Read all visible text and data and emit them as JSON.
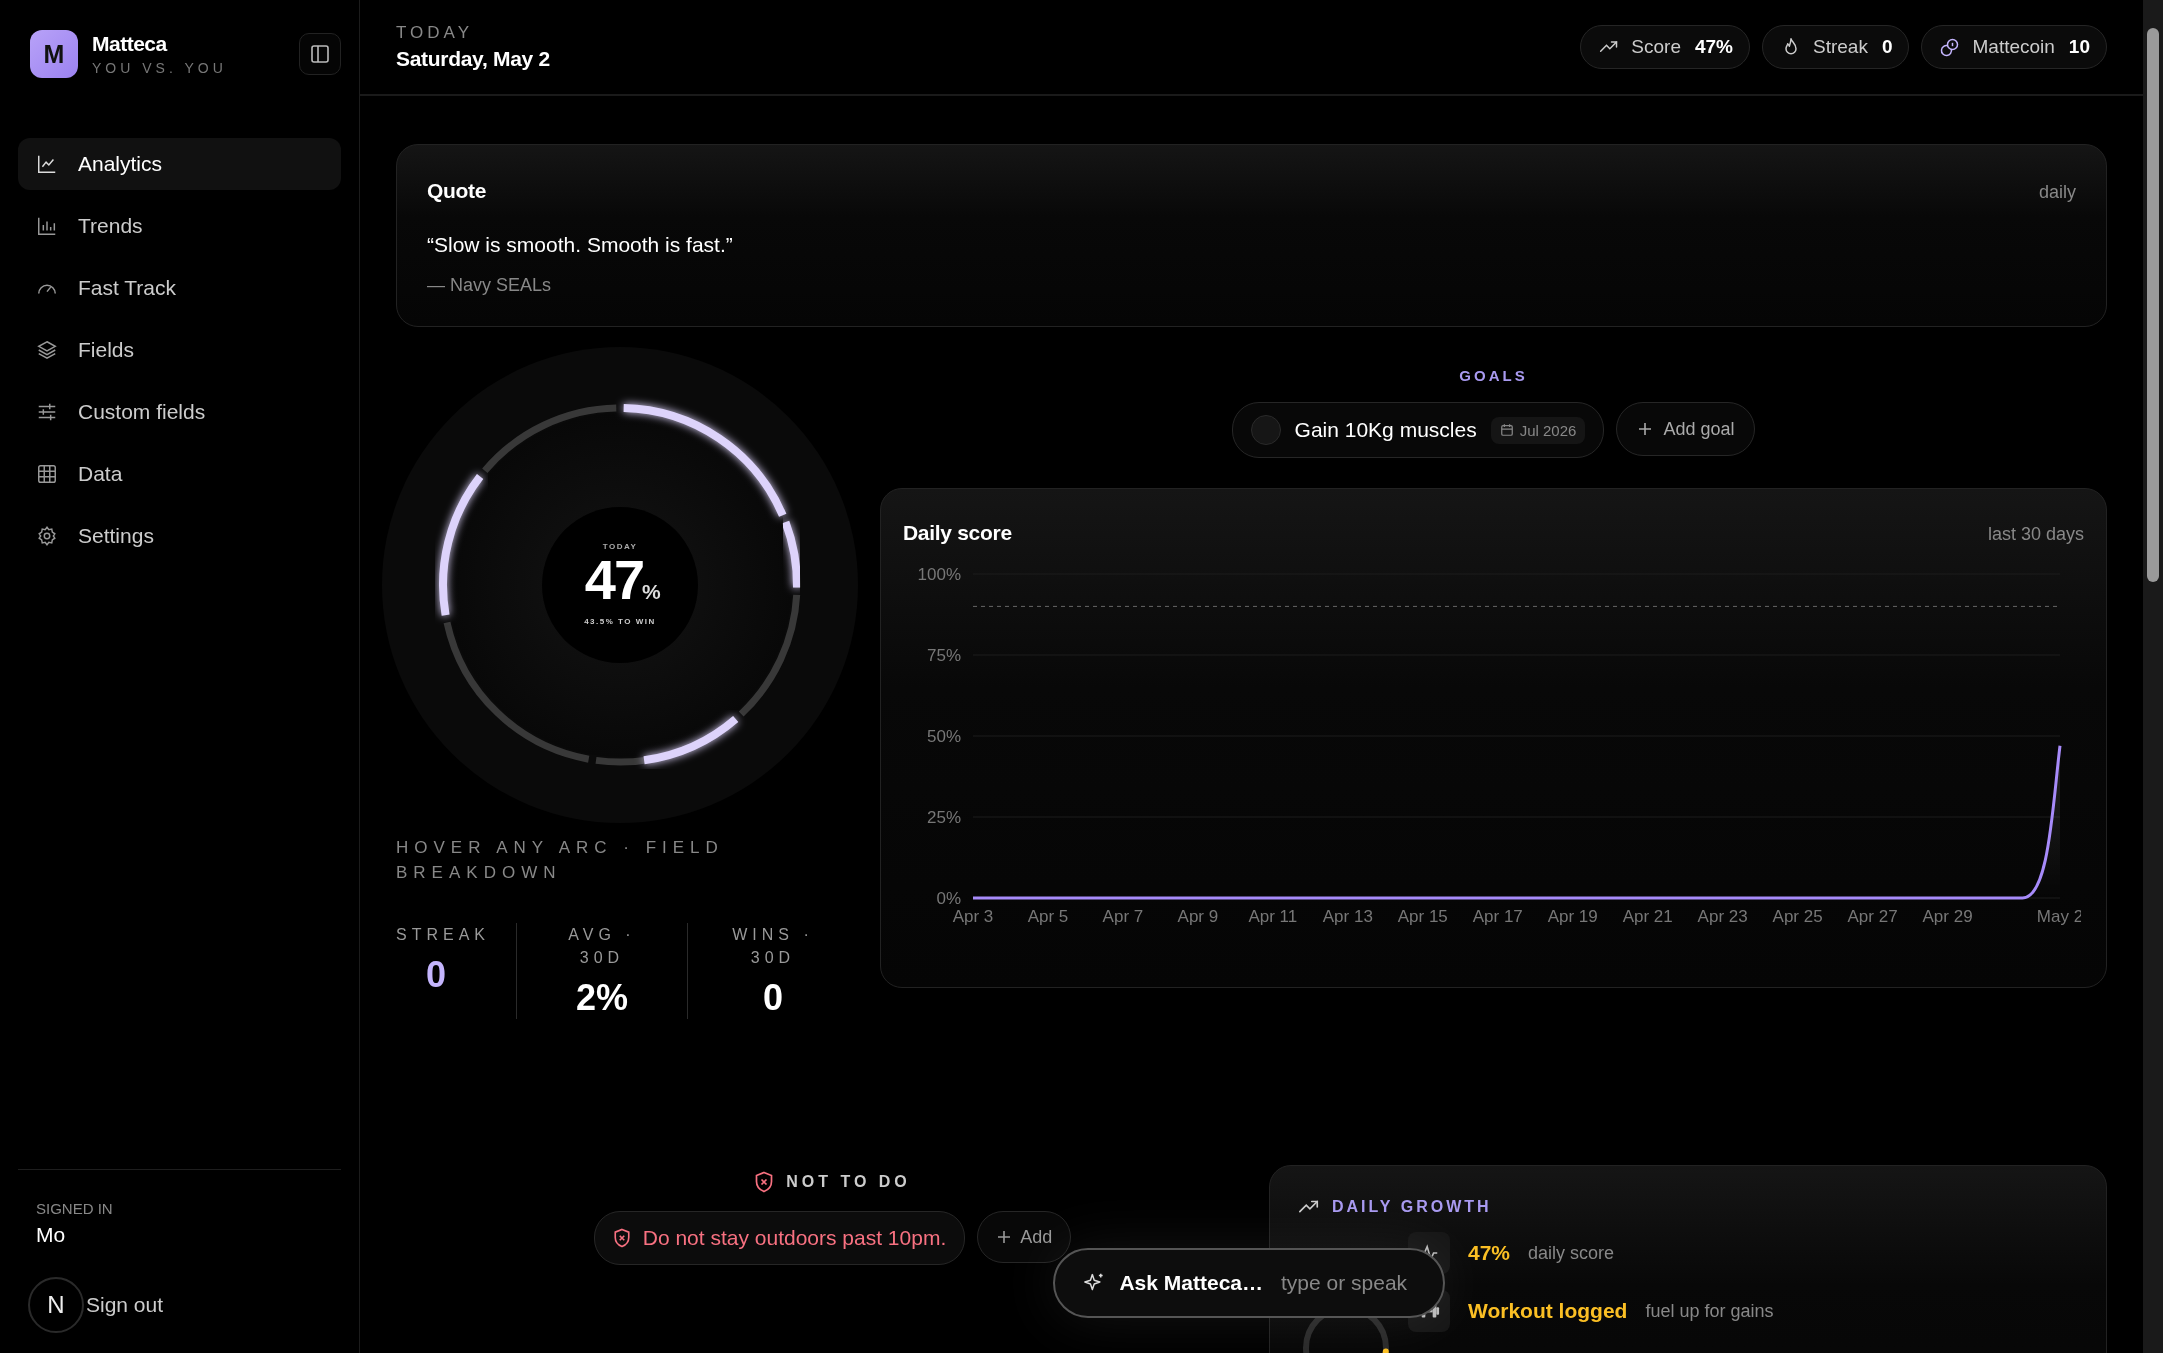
{
  "sidebar": {
    "logo": {
      "letter": "M",
      "name": "Matteca",
      "tagline": "YOU VS. YOU"
    },
    "nav": [
      {
        "label": "Analytics",
        "selected": true
      },
      {
        "label": "Trends",
        "selected": false
      },
      {
        "label": "Fast Track",
        "selected": false
      },
      {
        "label": "Fields",
        "selected": false
      },
      {
        "label": "Custom fields",
        "selected": false
      },
      {
        "label": "Data",
        "selected": false
      },
      {
        "label": "Settings",
        "selected": false
      }
    ],
    "signed_in": {
      "label": "SIGNED IN",
      "user": "Mo"
    },
    "dev_badge": "N",
    "sign_out": "Sign out"
  },
  "header": {
    "eyebrow": "TODAY",
    "date": "Saturday, May 2",
    "stats": [
      {
        "label": "Score",
        "value": "47%"
      },
      {
        "label": "Streak",
        "value": "0"
      },
      {
        "label": "Mattecoin",
        "value": "10"
      }
    ]
  },
  "quote": {
    "title": "Quote",
    "period": "daily",
    "text": "“Slow is smooth. Smooth is fast.”",
    "author": "— Navy SEALs"
  },
  "gauge": {
    "eyebrow": "TODAY",
    "value": "47",
    "unit": "%",
    "caption": "43.5% TO WIN",
    "hint": "HOVER ANY ARC · FIELD BREAKDOWN"
  },
  "stats": [
    {
      "label": "STREAK",
      "value": "0",
      "highlight": true
    },
    {
      "label": "AVG · 30D",
      "value": "2%",
      "highlight": false
    },
    {
      "label": "WINS · 30D",
      "value": "0",
      "highlight": false
    }
  ],
  "goals": {
    "title": "GOALS",
    "items": [
      {
        "label": "Gain 10Kg muscles",
        "due": "Jul 2026",
        "checked": false
      }
    ],
    "add": "Add goal"
  },
  "daily_score": {
    "title": "Daily score",
    "range": "last 30 days",
    "chart_data": {
      "type": "line",
      "categories": [
        "Apr 3",
        null,
        "Apr 5",
        null,
        "Apr 7",
        null,
        "Apr 9",
        null,
        "Apr 11",
        null,
        "Apr 13",
        null,
        "Apr 15",
        null,
        "Apr 17",
        null,
        "Apr 19",
        null,
        "Apr 21",
        null,
        "Apr 23",
        null,
        "Apr 25",
        null,
        "Apr 27",
        null,
        "Apr 29",
        null,
        null,
        "May 2"
      ],
      "grid": true,
      "series": [
        {
          "color": "#a78bfa",
          "values": [
            0,
            0,
            0,
            0,
            0,
            0,
            0,
            0,
            0,
            0,
            0,
            0,
            0,
            0,
            0,
            0,
            0,
            0,
            0,
            0,
            0,
            0,
            0,
            0,
            0,
            0,
            0,
            0,
            0,
            47
          ]
        }
      ],
      "ylim": [
        0,
        100
      ],
      "yticks": [
        {
          "value": 0,
          "label": "0%"
        },
        {
          "value": 25,
          "label": "25%"
        },
        {
          "value": 50,
          "label": "50%"
        },
        {
          "value": 75,
          "label": "75%"
        },
        {
          "value": 100,
          "label": "100%"
        }
      ],
      "ref_lines": [
        {
          "axis": "y",
          "value": 90
        }
      ]
    }
  },
  "not_to_do": {
    "title": "NOT TO DO",
    "items": [
      "Do not stay outdoors past 10pm."
    ],
    "add": "Add"
  },
  "daily_growth": {
    "title": "DAILY GROWTH",
    "rows": [
      {
        "value": "47%",
        "note": "daily score"
      },
      {
        "value": "Workout logged",
        "note": "fuel up for gains"
      }
    ]
  },
  "assistant": {
    "label": "Ask Matteca…",
    "placeholder": "type or speak"
  }
}
